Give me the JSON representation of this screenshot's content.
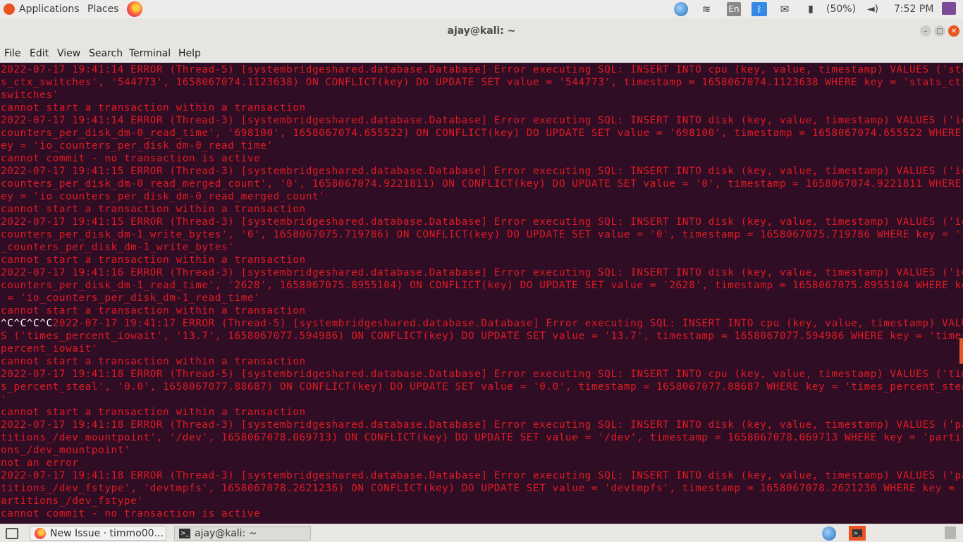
{
  "topbar": {
    "applications": "Applications",
    "places": "Places",
    "lang": "En",
    "battery": "(50%)",
    "clock": "7:52 PM"
  },
  "window": {
    "title": "ajay@kali: ~"
  },
  "menu": [
    "File",
    "Edit",
    "View",
    "Search",
    "Terminal",
    "Help"
  ],
  "terminal": {
    "text_color": "#e01b24",
    "lines": [
      "2022-07-17 19:41:14 ERROR (Thread-5) [systembridgeshared.database.Database] Error executing SQL: INSERT INTO cpu (key, value, timestamp) VALUES ('stat",
      "s_ctx_switches', '544773', 1658067074.1123638) ON CONFLICT(key) DO UPDATE SET value = '544773', timestamp = 1658067074.1123638 WHERE key = 'stats_ctx_",
      "switches'",
      "cannot start a transaction within a transaction",
      "2022-07-17 19:41:14 ERROR (Thread-3) [systembridgeshared.database.Database] Error executing SQL: INSERT INTO disk (key, value, timestamp) VALUES ('io_",
      "counters_per_disk_dm-0_read_time', '698100', 1658067074.655522) ON CONFLICT(key) DO UPDATE SET value = '698100', timestamp = 1658067074.655522 WHERE k",
      "ey = 'io_counters_per_disk_dm-0_read_time'",
      "cannot commit - no transaction is active",
      "2022-07-17 19:41:15 ERROR (Thread-3) [systembridgeshared.database.Database] Error executing SQL: INSERT INTO disk (key, value, timestamp) VALUES ('io_",
      "counters_per_disk_dm-0_read_merged_count', '0', 1658067074.9221811) ON CONFLICT(key) DO UPDATE SET value = '0', timestamp = 1658067074.9221811 WHERE k",
      "ey = 'io_counters_per_disk_dm-0_read_merged_count'",
      "cannot start a transaction within a transaction",
      "2022-07-17 19:41:15 ERROR (Thread-3) [systembridgeshared.database.Database] Error executing SQL: INSERT INTO disk (key, value, timestamp) VALUES ('io_",
      "counters_per_disk_dm-1_write_bytes', '0', 1658067075.719786) ON CONFLICT(key) DO UPDATE SET value = '0', timestamp = 1658067075.719786 WHERE key = 'io",
      "_counters_per_disk_dm-1_write_bytes'",
      "cannot start a transaction within a transaction",
      "2022-07-17 19:41:16 ERROR (Thread-3) [systembridgeshared.database.Database] Error executing SQL: INSERT INTO disk (key, value, timestamp) VALUES ('io_",
      "counters_per_disk_dm-1_read_time', '2628', 1658067075.8955104) ON CONFLICT(key) DO UPDATE SET value = '2628', timestamp = 1658067075.8955104 WHERE key",
      " = 'io_counters_per_disk_dm-1_read_time'",
      "cannot start a transaction within a transaction",
      "S ('times_percent_iowait', '13.7', 1658067077.594986) ON CONFLICT(key) DO UPDATE SET value = '13.7', timestamp = 1658067077.594986 WHERE key = 'times_",
      "percent_iowait'",
      "cannot start a transaction within a transaction",
      "2022-07-17 19:41:18 ERROR (Thread-5) [systembridgeshared.database.Database] Error executing SQL: INSERT INTO cpu (key, value, timestamp) VALUES ('time",
      "s_percent_steal', '0.0', 1658067077.88687) ON CONFLICT(key) DO UPDATE SET value = '0.0', timestamp = 1658067077.88687 WHERE key = 'times_percent_steal",
      "'",
      "cannot start a transaction within a transaction",
      "2022-07-17 19:41:18 ERROR (Thread-3) [systembridgeshared.database.Database] Error executing SQL: INSERT INTO disk (key, value, timestamp) VALUES ('par",
      "titions_/dev_mountpoint', '/dev', 1658067078.069713) ON CONFLICT(key) DO UPDATE SET value = '/dev', timestamp = 1658067078.069713 WHERE key = 'partiti",
      "ons_/dev_mountpoint'",
      "not an error",
      "2022-07-17 19:41:18 ERROR (Thread-3) [systembridgeshared.database.Database] Error executing SQL: INSERT INTO disk (key, value, timestamp) VALUES ('par",
      "titions_/dev_fstype', 'devtmpfs', 1658067078.2621236) ON CONFLICT(key) DO UPDATE SET value = 'devtmpfs', timestamp = 1658067078.2621236 WHERE key = 'p",
      "artitions_/dev_fstype'",
      "cannot commit - no transaction is active"
    ],
    "interrupt_prefix": "^C^C^C^C",
    "interrupt_rest": "2022-07-17 19:41:17 ERROR (Thread-5) [systembridgeshared.database.Database] Error executing SQL: INSERT INTO cpu (key, value, timestamp) VALUE"
  },
  "taskbar": {
    "firefox_task": "New Issue · timmo00...",
    "terminal_task": "ajay@kali: ~"
  }
}
